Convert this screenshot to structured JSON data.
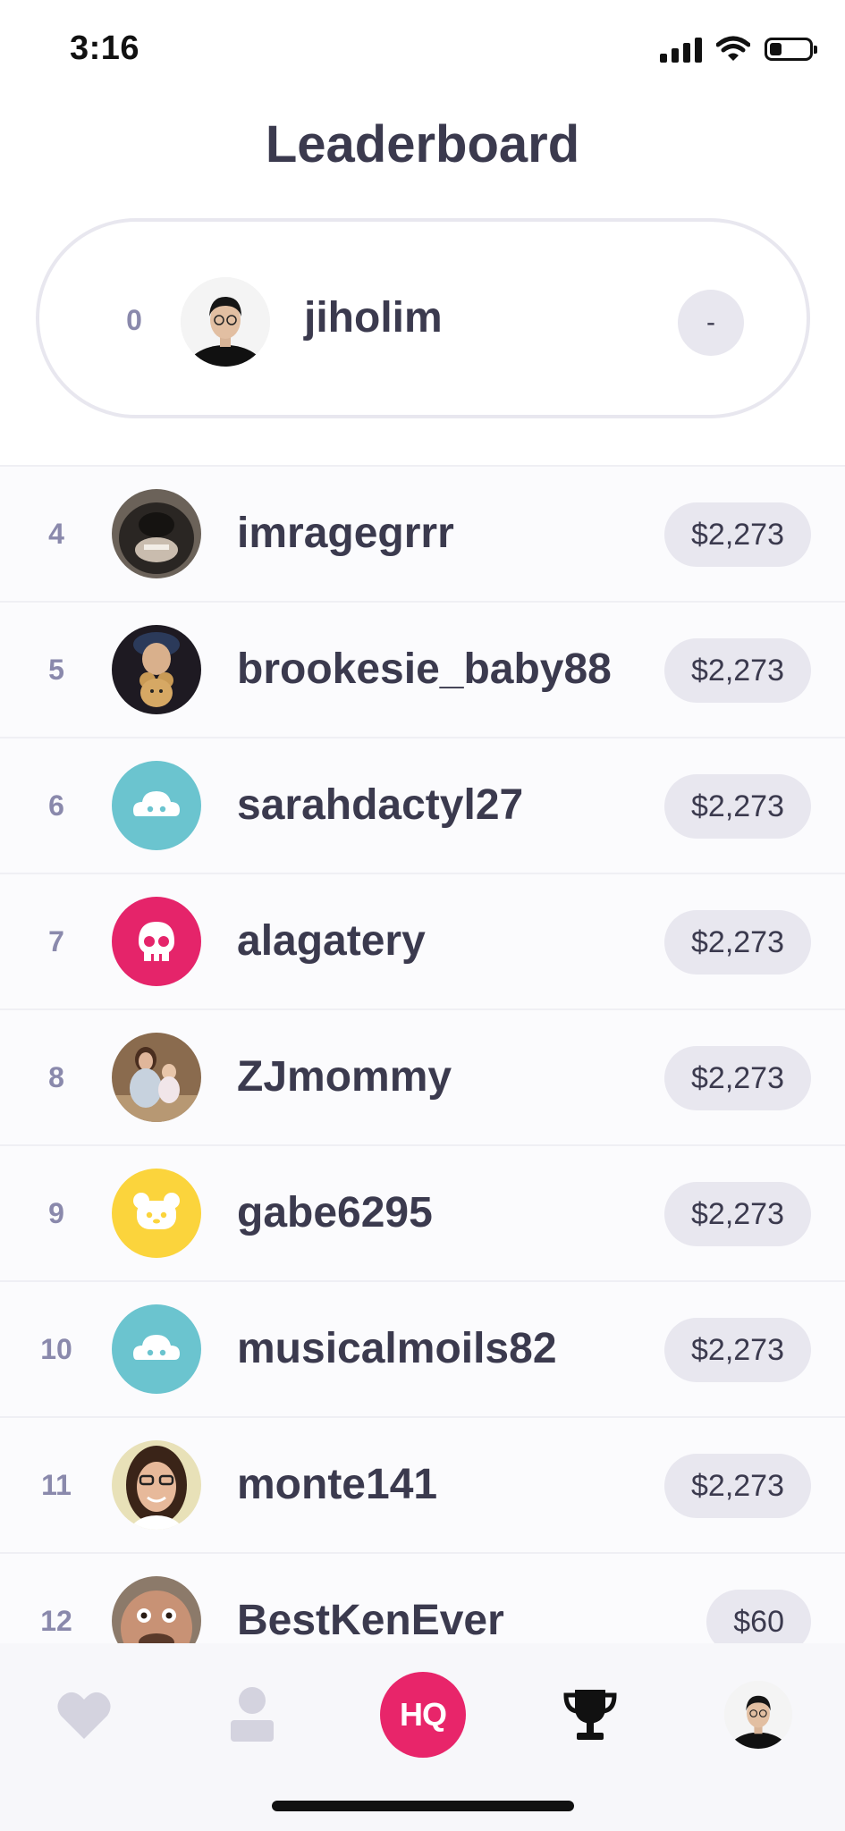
{
  "status_bar": {
    "time": "3:16",
    "battery_level": 0.3,
    "icons": [
      "signal-icon",
      "wifi-icon",
      "battery-icon"
    ]
  },
  "header": {
    "title": "Leaderboard"
  },
  "my_entry": {
    "rank": "0",
    "username": "jiholim",
    "score": "-"
  },
  "leaderboard": [
    {
      "rank": "4",
      "username": "imragegrrr",
      "prize": "$2,273",
      "avatar": "photo-dog-icon"
    },
    {
      "rank": "5",
      "username": "brookesie_baby88",
      "prize": "$2,273",
      "avatar": "photo-person-bear-icon"
    },
    {
      "rank": "6",
      "username": "sarahdactyl27",
      "prize": "$2,273",
      "avatar": "cloud-icon",
      "avatar_color": "#6bc4cf"
    },
    {
      "rank": "7",
      "username": "alagatery",
      "prize": "$2,273",
      "avatar": "skull-icon",
      "avatar_color": "#e5246a"
    },
    {
      "rank": "8",
      "username": "ZJmommy",
      "prize": "$2,273",
      "avatar": "photo-family-icon"
    },
    {
      "rank": "9",
      "username": "gabe6295",
      "prize": "$2,273",
      "avatar": "bear-icon",
      "avatar_color": "#fbd43c"
    },
    {
      "rank": "10",
      "username": "musicalmoils82",
      "prize": "$2,273",
      "avatar": "cloud-icon",
      "avatar_color": "#6bc4cf"
    },
    {
      "rank": "11",
      "username": "monte141",
      "prize": "$2,273",
      "avatar": "photo-woman-glasses-icon"
    },
    {
      "rank": "12",
      "username": "BestKenEver",
      "prize": "$60",
      "avatar": "photo-man-face-icon"
    }
  ],
  "tabbar": {
    "hq_label": "HQ",
    "tabs": [
      "heart-icon",
      "person-icon",
      "hq-icon",
      "trophy-icon",
      "profile-avatar-icon"
    ]
  },
  "colors": {
    "accent": "#e8256a",
    "text": "#3b3a4e",
    "muted": "#8a89ac",
    "pill": "#e8e7ef"
  }
}
